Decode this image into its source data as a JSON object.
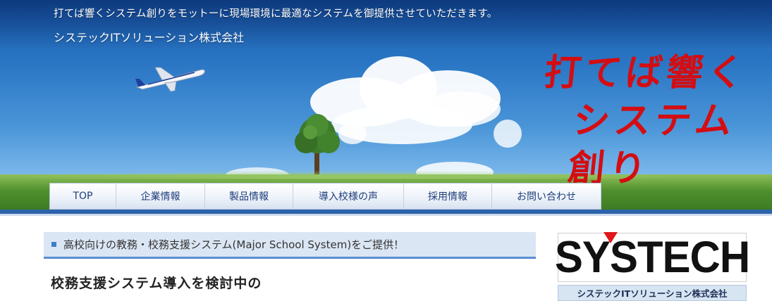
{
  "header": {
    "tagline": "打てば響くシステム創りをモットーに現場環境に最適なシステムを御提供させていただきます。",
    "company_name": "システックITソリューション株式会社",
    "slogan_line1": "打てば響く",
    "slogan_line2": "システム創り"
  },
  "nav": {
    "items": [
      {
        "label": "TOP"
      },
      {
        "label": "企業情報"
      },
      {
        "label": "製品情報"
      },
      {
        "label": "導入校様の声"
      },
      {
        "label": "採用情報"
      },
      {
        "label": "お問い合わせ"
      }
    ]
  },
  "main": {
    "banner_text": "高校向けの教務・校務支援システム(Major School System)をご提供！",
    "heading": "校務支援システム導入を検討中の"
  },
  "sidebar": {
    "logo_text": "SYSTECH",
    "logo_subtitle": "システックITソリューション株式会社"
  },
  "colors": {
    "accent": "#2c63ab",
    "slogan_red": "#d40d12",
    "nav_text": "#1d3d7a"
  }
}
